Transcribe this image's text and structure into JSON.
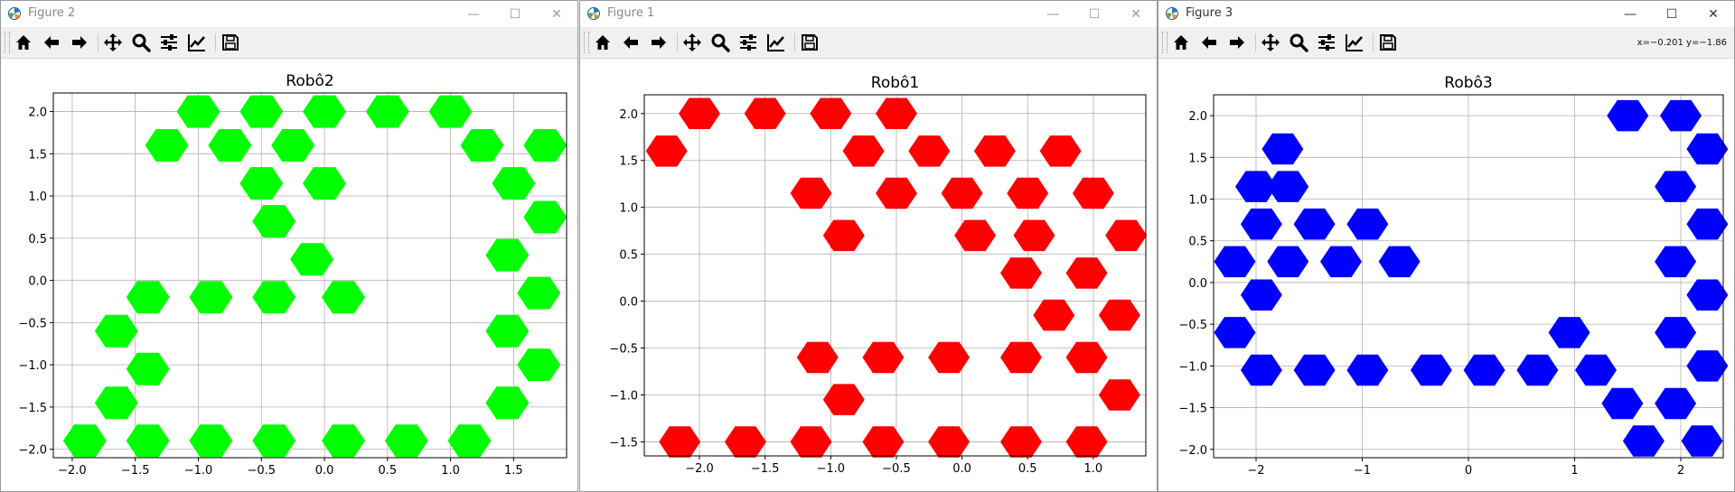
{
  "windows": [
    {
      "title": "Figure 2",
      "active": false,
      "coords": "",
      "chart_data": {
        "type": "scatter",
        "title": "Robô2",
        "marker": "hexagon",
        "series": [
          {
            "color": "#00ff00",
            "x": [
              -1.0,
              -0.5,
              0.0,
              0.5,
              1.0,
              -1.25,
              -0.75,
              -0.25,
              1.25,
              1.75,
              -0.5,
              0.0,
              1.5,
              -0.4,
              1.75,
              -0.1,
              1.45,
              -1.4,
              -0.9,
              -0.4,
              0.15,
              1.7,
              -1.65,
              1.45,
              -1.4,
              1.7,
              -1.65,
              1.45,
              -1.9,
              -1.4,
              -0.9,
              -0.4,
              0.15,
              0.65,
              1.15
            ],
            "y": [
              2.0,
              2.0,
              2.0,
              2.0,
              2.0,
              1.6,
              1.6,
              1.6,
              1.6,
              1.6,
              1.15,
              1.15,
              1.15,
              0.7,
              0.75,
              0.25,
              0.3,
              -0.2,
              -0.2,
              -0.2,
              -0.2,
              -0.15,
              -0.6,
              -0.6,
              -1.05,
              -1.0,
              -1.45,
              -1.45,
              -1.9,
              -1.9,
              -1.9,
              -1.9,
              -1.9,
              -1.9,
              -1.9
            ]
          }
        ],
        "xlim": [
          -2.15,
          1.92
        ],
        "ylim": [
          -2.1,
          2.22
        ],
        "xticks": [
          -2.0,
          -1.5,
          -1.0,
          -0.5,
          0.0,
          0.5,
          1.0,
          1.5
        ],
        "yticks": [
          -2.0,
          -1.5,
          -1.0,
          -0.5,
          0.0,
          0.5,
          1.0,
          1.5,
          2.0
        ],
        "xtick_labels": [
          "−2.0",
          "−1.5",
          "−1.0",
          "−0.5",
          "0.0",
          "0.5",
          "1.0",
          "1.5"
        ],
        "ytick_labels": [
          "−2.0",
          "−1.5",
          "−1.0",
          "−0.5",
          "0.0",
          "0.5",
          "1.0",
          "1.5",
          "2.0"
        ],
        "grid": true
      }
    },
    {
      "title": "Figure 1",
      "active": false,
      "coords": "",
      "chart_data": {
        "type": "scatter",
        "title": "Robô1",
        "marker": "hexagon",
        "series": [
          {
            "color": "#ff0000",
            "x": [
              -2.0,
              -1.5,
              -1.0,
              -0.5,
              -2.25,
              -0.75,
              -0.25,
              0.25,
              0.75,
              -1.15,
              -0.5,
              0.0,
              0.5,
              1.0,
              -0.9,
              0.1,
              0.55,
              1.25,
              0.45,
              0.95,
              0.7,
              1.2,
              -1.1,
              -0.6,
              -0.1,
              0.45,
              0.95,
              -0.9,
              1.2,
              -2.15,
              -1.65,
              -1.15,
              -0.6,
              -0.1,
              0.45,
              0.95
            ],
            "y": [
              2.0,
              2.0,
              2.0,
              2.0,
              1.6,
              1.6,
              1.6,
              1.6,
              1.6,
              1.15,
              1.15,
              1.15,
              1.15,
              1.15,
              0.7,
              0.7,
              0.7,
              0.7,
              0.3,
              0.3,
              -0.15,
              -0.15,
              -0.6,
              -0.6,
              -0.6,
              -0.6,
              -0.6,
              -1.05,
              -1.0,
              -1.5,
              -1.5,
              -1.5,
              -1.5,
              -1.5,
              -1.5,
              -1.5
            ]
          }
        ],
        "xlim": [
          -2.42,
          1.4
        ],
        "ylim": [
          -1.65,
          2.2
        ],
        "xticks": [
          -2.0,
          -1.5,
          -1.0,
          -0.5,
          0.0,
          0.5,
          1.0
        ],
        "yticks": [
          -1.5,
          -1.0,
          -0.5,
          0.0,
          0.5,
          1.0,
          1.5,
          2.0
        ],
        "xtick_labels": [
          "−2.0",
          "−1.5",
          "−1.0",
          "−0.5",
          "0.0",
          "0.5",
          "1.0"
        ],
        "ytick_labels": [
          "−1.5",
          "−1.0",
          "−0.5",
          "0.0",
          "0.5",
          "1.0",
          "1.5",
          "2.0"
        ],
        "grid": true
      }
    },
    {
      "title": "Figure 3",
      "active": true,
      "coords": "x=−0.201 y=−1.86",
      "chart_data": {
        "type": "scatter",
        "title": "Robô3",
        "marker": "hexagon",
        "series": [
          {
            "color": "#0000ff",
            "x": [
              1.5,
              2.0,
              -1.75,
              2.25,
              -2.0,
              -1.7,
              1.95,
              -1.95,
              -1.45,
              -0.95,
              2.25,
              -2.2,
              -1.7,
              -1.2,
              -0.65,
              1.95,
              -1.95,
              2.25,
              -2.2,
              0.95,
              1.95,
              -1.95,
              -1.45,
              -0.95,
              -0.35,
              0.15,
              0.65,
              1.2,
              2.25,
              1.45,
              1.95,
              1.65,
              2.2
            ],
            "y": [
              2.0,
              2.0,
              1.6,
              1.6,
              1.15,
              1.15,
              1.15,
              0.7,
              0.7,
              0.7,
              0.7,
              0.25,
              0.25,
              0.25,
              0.25,
              0.25,
              -0.15,
              -0.15,
              -0.6,
              -0.6,
              -0.6,
              -1.05,
              -1.05,
              -1.05,
              -1.05,
              -1.05,
              -1.05,
              -1.05,
              -1.0,
              -1.45,
              -1.45,
              -1.9,
              -1.9
            ]
          }
        ],
        "xlim": [
          -2.4,
          2.4
        ],
        "ylim": [
          -2.1,
          2.25
        ],
        "xticks": [
          -2,
          -1,
          0,
          1,
          2
        ],
        "yticks": [
          -2.0,
          -1.5,
          -1.0,
          -0.5,
          0.0,
          0.5,
          1.0,
          1.5,
          2.0
        ],
        "xtick_labels": [
          "−2",
          "−1",
          "0",
          "1",
          "2"
        ],
        "ytick_labels": [
          "−2.0",
          "−1.5",
          "−1.0",
          "−0.5",
          "0.0",
          "0.5",
          "1.0",
          "1.5",
          "2.0"
        ],
        "grid": true
      }
    }
  ]
}
